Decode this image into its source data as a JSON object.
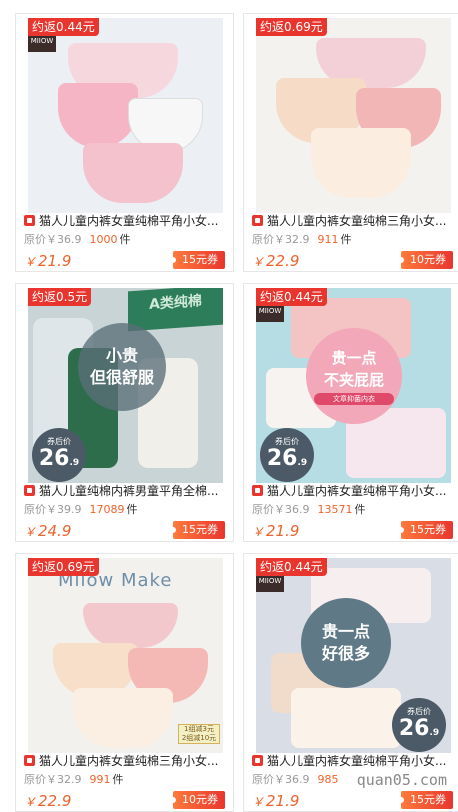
{
  "products": [
    {
      "rebate": "约返0.44元",
      "title": "猫人儿童内裤女童纯棉平角小女...",
      "orig_price": "原价￥36.9",
      "sold": "1000",
      "unit": "件",
      "price": "21.9",
      "coupon": "15元券",
      "art": "pink-set"
    },
    {
      "rebate": "约返0.69元",
      "title": "猫人儿童内裤女童纯棉三角小女...",
      "orig_price": "原价￥32.9",
      "sold": "911",
      "unit": "件",
      "price": "22.9",
      "coupon": "10元券",
      "art": "peach-set"
    },
    {
      "rebate": "约返0.5元",
      "title": "猫人儿童纯棉内裤男童平角全棉...",
      "orig_price": "原价￥39.9",
      "sold": "17089",
      "unit": "件",
      "price": "24.9",
      "coupon": "15元券",
      "art": "boys-box",
      "badge_lines": [
        "小贵",
        "但很舒服"
      ],
      "after_label": "券后价",
      "after_value": "26",
      "after_small": ".9",
      "banner": "A类纯棉"
    },
    {
      "rebate": "约返0.44元",
      "title": "猫人儿童内裤女童纯棉平角小女...",
      "orig_price": "原价￥36.9",
      "sold": "13571",
      "unit": "件",
      "price": "21.9",
      "coupon": "15元券",
      "art": "girls-boxer",
      "badge_lines": [
        "贵一点",
        "不夹屁屁"
      ],
      "badge_sub": "文章抑菌内衣",
      "after_label": "券后价",
      "after_value": "26",
      "after_small": ".9"
    },
    {
      "rebate": "约返0.69元",
      "title": "猫人儿童内裤女童纯棉三角小女...",
      "orig_price": "原价￥32.9",
      "sold": "991",
      "unit": "件",
      "price": "22.9",
      "coupon": "10元券",
      "art": "miiow-make",
      "banner": "Miiow Make",
      "note_lines": [
        "1组减3元",
        "2组减10元"
      ]
    },
    {
      "rebate": "约返0.44元",
      "title": "猫人儿童内裤女童纯棉平角小女...",
      "orig_price": "原价￥36.9",
      "sold": "985",
      "unit": "",
      "price": "21.9",
      "coupon": "15元券",
      "art": "girls-boxer-2",
      "badge_lines": [
        "贵一点",
        "好很多"
      ],
      "after_label": "券后价",
      "after_value": "26",
      "after_small": ".9"
    }
  ],
  "brand_text": "MIIOW",
  "currency": "￥",
  "watermark": "quan05.com"
}
